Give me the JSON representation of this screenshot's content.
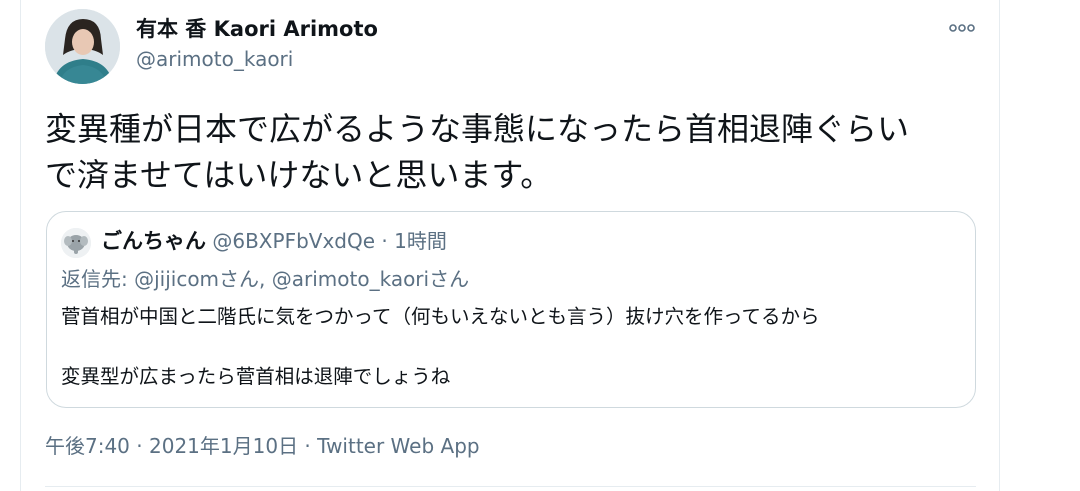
{
  "author": {
    "display_name": "有本 香 Kaori Arimoto",
    "handle": "@arimoto_kaori"
  },
  "tweet": {
    "text_line1": "変異種が日本で広がるような事態になったら首相退陣ぐらい",
    "text_line2": "で済ませてはいけないと思います。"
  },
  "quote": {
    "name": "ごんちゃん",
    "handle": "@6BXPFbVxdQe",
    "separator": " · ",
    "time": "1時間",
    "reply_to": "返信先: @jijicomさん, @arimoto_kaoriさん",
    "body_line1": "菅首相が中国と二階氏に気をつかって（何もいえないとも言う）抜け穴を作ってるから",
    "body_line2": "変異型が広まったら菅首相は退陣でしょうね"
  },
  "footer": {
    "time": "午後7:40",
    "sep1": " · ",
    "date": "2021年1月10日",
    "sep2": " · ",
    "source": "Twitter Web App"
  },
  "icons": {
    "more": "more-icon",
    "avatar": "profile-photo",
    "quote_avatar": "elephant-avatar"
  },
  "colors": {
    "text": "#0f1419",
    "secondary": "#5b7083",
    "border": "#cfd9de"
  }
}
